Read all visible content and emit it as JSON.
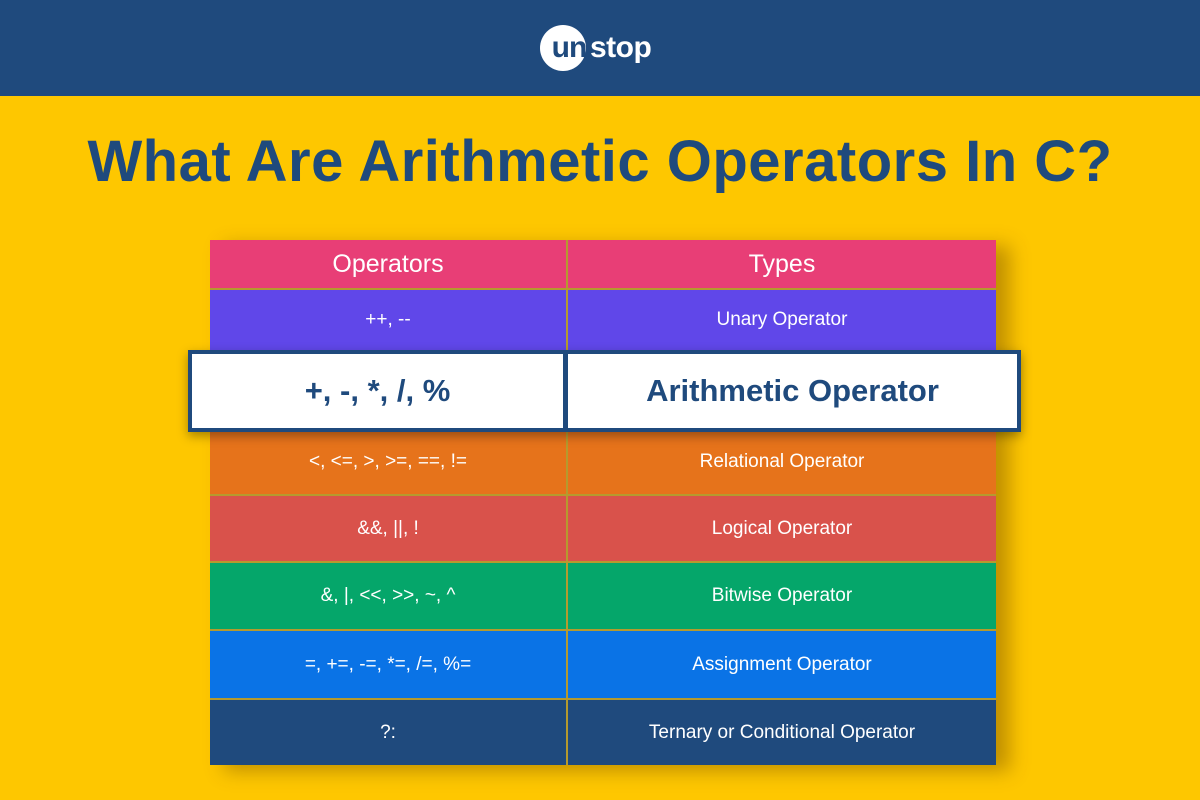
{
  "header": {
    "logo_circle_text": "un",
    "logo_rest_text": "stop",
    "background": "#1f4a7d"
  },
  "title": "What Are Arithmetic Operators In C?",
  "table": {
    "columns": [
      "Operators",
      "Types"
    ],
    "header_color": "#e83e76",
    "rows": [
      {
        "operators": "++, --",
        "type": "Unary Operator",
        "color": "#6047e9"
      },
      {
        "operators": "+, -, *, /, %",
        "type": "Arithmetic Operator",
        "color": "#ffffff",
        "highlighted": true
      },
      {
        "operators": "<, <=, >, >=, ==, !=",
        "type": "Relational Operator",
        "color": "#e6731b"
      },
      {
        "operators": "&&, ||, !",
        "type": "Logical Operator",
        "color": "#d9524b"
      },
      {
        "operators": "&, |, <<, >>, ~, ^",
        "type": "Bitwise Operator",
        "color": "#05a66a"
      },
      {
        "operators": "=, +=, -=, *=, /=, %=",
        "type": "Assignment Operator",
        "color": "#0a73e6"
      },
      {
        "operators": "?:",
        "type": "Ternary or Conditional Operator",
        "color": "#1f4a7d"
      }
    ]
  }
}
